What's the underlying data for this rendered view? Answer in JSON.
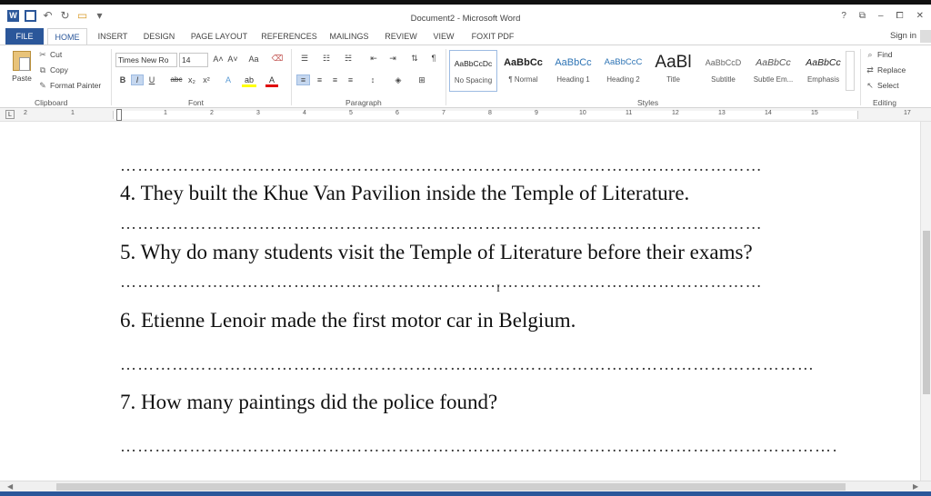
{
  "window": {
    "title": "Document2 - Microsoft Word",
    "controls": [
      "?",
      "⧉",
      "–",
      "⧠",
      "✕"
    ],
    "sign_in": "Sign in"
  },
  "qat": {
    "icons": [
      "word-logo-icon",
      "save-icon",
      "undo-icon",
      "redo-icon",
      "open-icon",
      "customize-qat-icon"
    ]
  },
  "tabs": {
    "file": "FILE",
    "items": [
      "HOME",
      "INSERT",
      "DESIGN",
      "PAGE LAYOUT",
      "REFERENCES",
      "MAILINGS",
      "REVIEW",
      "VIEW",
      "FOXIT PDF"
    ],
    "active": "HOME"
  },
  "clipboard": {
    "paste": "Paste",
    "cut": "Cut",
    "copy": "Copy",
    "format_painter": "Format Painter",
    "group": "Clipboard"
  },
  "font": {
    "name": "Times New Ro",
    "size": "14",
    "grow": "A˄",
    "shrink": "A˅",
    "case": "Aa",
    "bold": "B",
    "italic": "I",
    "underline": "U",
    "strike": "abc",
    "subscript": "x₂",
    "superscript": "x²",
    "group": "Font"
  },
  "paragraph": {
    "group": "Paragraph"
  },
  "styles": {
    "group": "Styles",
    "items": [
      {
        "sample": "AaBbCcDc",
        "name": "No Spacing"
      },
      {
        "sample": "AaBbCc",
        "name": "¶ Normal"
      },
      {
        "sample": "AaBbCc",
        "name": "Heading 1"
      },
      {
        "sample": "AaBbCcC",
        "name": "Heading 2"
      },
      {
        "sample": "AaBl",
        "name": "Title"
      },
      {
        "sample": "AaBbCcD",
        "name": "Subtitle"
      },
      {
        "sample": "AaBbCc",
        "name": "Subtle Em..."
      },
      {
        "sample": "AaBbCc",
        "name": "Emphasis"
      }
    ]
  },
  "editing": {
    "find": "Find",
    "replace": "Replace",
    "select": "Select",
    "group": "Editing"
  },
  "ruler": {
    "numbers": [
      "2",
      "1",
      "1",
      "2",
      "3",
      "4",
      "5",
      "6",
      "7",
      "8",
      "9",
      "10",
      "11",
      "12",
      "13",
      "14",
      "15",
      "17"
    ]
  },
  "document": {
    "lines": [
      "4. They built the Khue Van Pavilion inside the Temple of Literature.",
      "5. Why do many students visit the Temple of Literature before their exams?",
      "6. Etienne Lenoir made the first motor car in Belgium.",
      "7. How many paintings did the police found?"
    ],
    "dots_short": "…………………………………………………………………………………………………………………………………………………………………………………………………………………………………………………………………………",
    "dots_long": "………………………………………………………………………………………………………………………………………………………………………………………………………………………………………………………………………………………………",
    "cursor": "I"
  }
}
